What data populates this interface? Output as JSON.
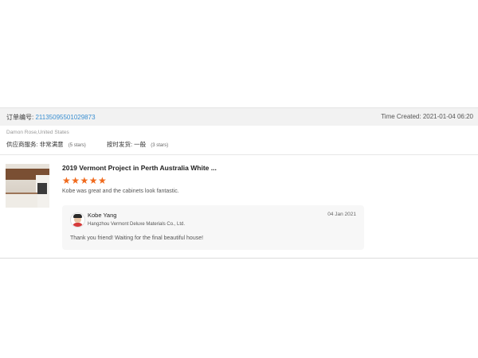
{
  "order": {
    "number_label": "订单编号:",
    "number": "21135095501029873",
    "time_created": "Time Created: 2021-01-04 06:20"
  },
  "buyer": {
    "name_location": "Damon Rose,United States"
  },
  "ratings": {
    "service_label": "供应商服务: 非常满意",
    "service_stars": "(5 stars)",
    "delivery_label": "按时发货: 一般",
    "delivery_stars": "(3 stars)"
  },
  "review": {
    "product_title": "2019 Vermont Project in Perth Australia White ...",
    "stars": "★★★★★",
    "rating": 5,
    "text": "Kobe was great and the cabinets look fantastic."
  },
  "reply": {
    "name": "Kobe Yang",
    "company": "Hangzhou Vermont Deluxe Materials Co., Ltd.",
    "date": "04 Jan 2021",
    "text": "Thank you friend! Waiting for the final beautiful house!"
  },
  "colors": {
    "accent_link": "#3a8fd1",
    "star": "#f06a1d"
  }
}
